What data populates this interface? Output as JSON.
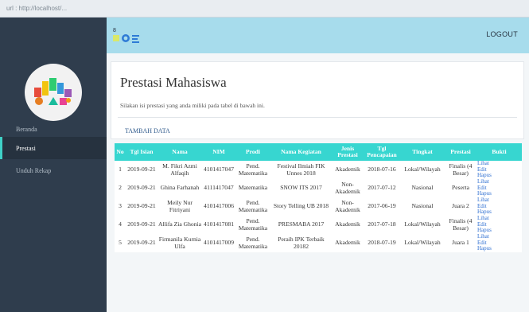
{
  "browser": {
    "url": "url : http://localhost/..."
  },
  "sidebar": {
    "items": [
      {
        "label": "Beranda"
      },
      {
        "label": "Prestasi"
      },
      {
        "label": "Unduh Rekap"
      }
    ]
  },
  "header": {
    "logout_label": "LOGOUT"
  },
  "main": {
    "title": "Prestasi Mahasiswa",
    "subtitle": "Silakan isi prestasi yang anda miliki pada tabel di bawah ini.",
    "add_label": "TAMBAH DATA"
  },
  "table": {
    "headers": [
      "No",
      "Tgl Isian",
      "Nama",
      "NIM",
      "Prodi",
      "Nama Kegiatan",
      "Jenis Prestasi",
      "Tgl Pencapaian",
      "Tingkat",
      "Prestasi",
      "Bukti"
    ],
    "actions": [
      "Lihat",
      "Edit",
      "Hapus"
    ],
    "rows": [
      [
        "1",
        "2019-09-21",
        "M. Fikri Azmi Alfaqih",
        "4101417047",
        "Pend. Matematika",
        "Festival Ilmiah FIK Unnes 2018",
        "Akademik",
        "2018-07-16",
        "Lokal/Wilayah",
        "Finalis (4 Besar)"
      ],
      [
        "2",
        "2019-09-21",
        "Ghina Farhanah",
        "4111417047",
        "Matematika",
        "SNOW ITS 2017",
        "Non-Akademik",
        "2017-07-12",
        "Nasional",
        "Peserta"
      ],
      [
        "3",
        "2019-09-21",
        "Meily Nur Fitriyani",
        "4101417006",
        "Pend. Matematika",
        "Story Telling UB 2018",
        "Non-Akademik",
        "2017-06-19",
        "Nasional",
        "Juara 2"
      ],
      [
        "4",
        "2019-09-21",
        "Allifa Zia Ghonia",
        "4101417081",
        "Pend. Matematika",
        "PRESMABA 2017",
        "Akademik",
        "2017-07-18",
        "Lokal/Wilayah",
        "Finalis (4 Besar)"
      ],
      [
        "5",
        "2019-09-21",
        "Firmanila Kurnia Ulfa",
        "4101417009",
        "Pend. Matematika",
        "Peraih IPK Terbaik 20182",
        "Akademik",
        "2018-07-19",
        "Lokal/Wilayah",
        "Juara 1"
      ]
    ]
  },
  "colors": {
    "sidebar": "#2f3d4d",
    "topbar": "#a7dcec",
    "table_header": "#37d6d0",
    "link": "#2e6fd1"
  }
}
